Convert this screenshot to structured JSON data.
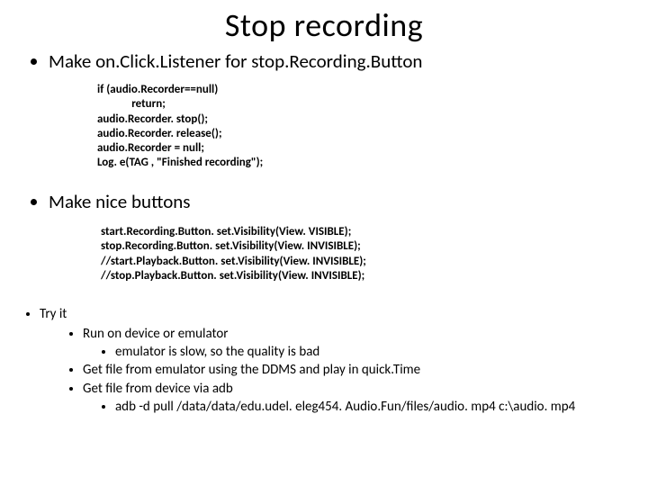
{
  "title": "Stop recording",
  "section1": {
    "heading": "Make on.Click.Listener for stop.Recording.Button",
    "code": "if (audio.Recorder==null)\n             return;\naudio.Recorder. stop();\naudio.Recorder. release();\naudio.Recorder = null;\nLog. e(TAG , \"Finished recording\");"
  },
  "section2": {
    "heading": "Make nice buttons",
    "code": "start.Recording.Button. set.Visibility(View. VISIBLE);\nstop.Recording.Button. set.Visibility(View. INVISIBLE);\n//start.Playback.Button. set.Visibility(View. INVISIBLE);\n//stop.Playback.Button. set.Visibility(View. INVISIBLE);"
  },
  "section3": {
    "heading": "Try it",
    "items": [
      {
        "text": "Run on device or emulator",
        "sub": [
          "emulator is slow, so the quality is bad"
        ]
      },
      {
        "text": "Get file from emulator using the DDMS and play in quick.Time",
        "sub": []
      },
      {
        "text": "Get file from device via adb",
        "sub": [
          "adb -d pull /data/data/edu.udel. eleg454. Audio.Fun/files/audio. mp4 c:\\audio. mp4"
        ]
      }
    ]
  }
}
